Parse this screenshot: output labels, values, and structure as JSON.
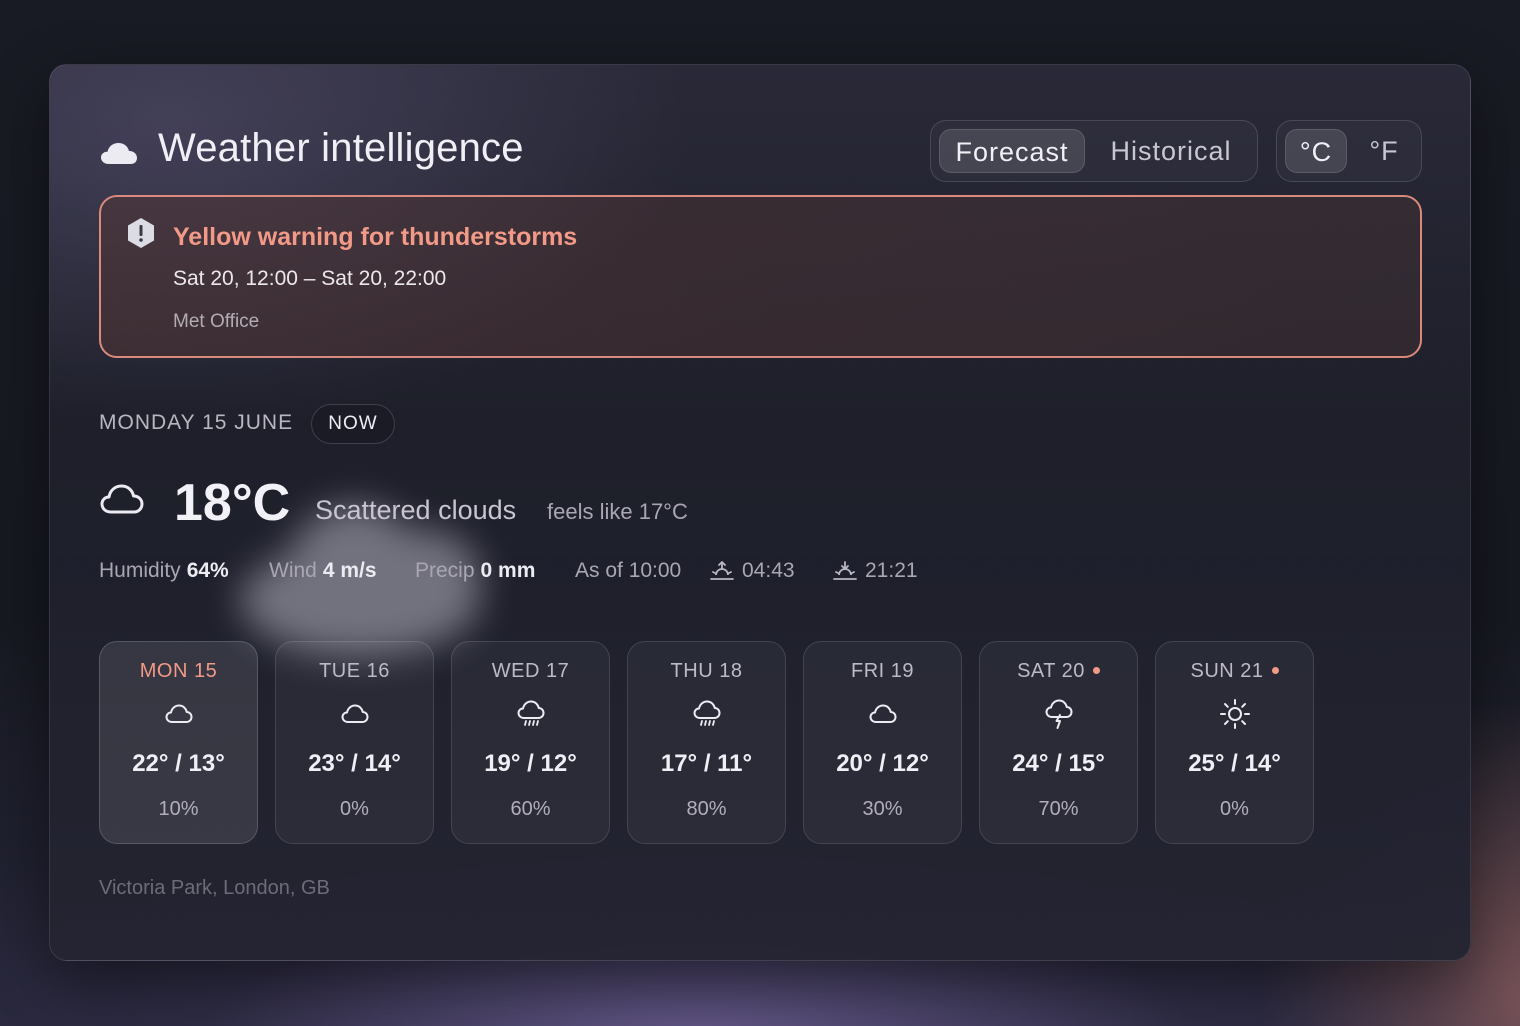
{
  "app": {
    "title": "Weather intelligence",
    "title_icon": "cloud-icon"
  },
  "view_toggle": {
    "options": [
      {
        "label": "Forecast",
        "active": true
      },
      {
        "label": "Historical",
        "active": false
      }
    ]
  },
  "unit_toggle": {
    "options": [
      {
        "label": "°C",
        "active": true
      },
      {
        "label": "°F",
        "active": false
      }
    ]
  },
  "alert": {
    "icon": "warning-icon",
    "title": "Yellow warning for thunderstorms",
    "time": "Sat 20, 12:00 – Sat 20, 22:00",
    "source": "Met Office",
    "accent": "#f29a87"
  },
  "current": {
    "date": "MONDAY 15 JUNE",
    "badge": "NOW",
    "icon": "cloud-icon",
    "temperature": "18°C",
    "description": "Scattered clouds",
    "feels_like": "feels like 17°C",
    "humidity_label": "Humidity",
    "humidity_value": "64%",
    "wind_label": "Wind",
    "wind_value": "4 m/s",
    "precip_label": "Precip",
    "precip_value": "0 mm",
    "as_of": "As of 10:00",
    "sunrise": "04:43",
    "sunset": "21:21"
  },
  "forecast": [
    {
      "day": "MON 15",
      "icon": "cloud-icon",
      "temps": "22° / 13°",
      "precip": "10%",
      "selected": true,
      "alert_dot": false
    },
    {
      "day": "TUE 16",
      "icon": "cloud-icon",
      "temps": "23° / 14°",
      "precip": "0%",
      "selected": false,
      "alert_dot": false
    },
    {
      "day": "WED 17",
      "icon": "rain-icon",
      "temps": "19° / 12°",
      "precip": "60%",
      "selected": false,
      "alert_dot": false
    },
    {
      "day": "THU 18",
      "icon": "rain-icon",
      "temps": "17° / 11°",
      "precip": "80%",
      "selected": false,
      "alert_dot": false
    },
    {
      "day": "FRI 19",
      "icon": "cloud-icon",
      "temps": "20° / 12°",
      "precip": "30%",
      "selected": false,
      "alert_dot": false
    },
    {
      "day": "SAT 20",
      "icon": "thunderstorm-icon",
      "temps": "24° / 15°",
      "precip": "70%",
      "selected": false,
      "alert_dot": true
    },
    {
      "day": "SUN 21",
      "icon": "sun-icon",
      "temps": "25° / 14°",
      "precip": "0%",
      "selected": false,
      "alert_dot": true
    }
  ],
  "location": "Victoria Park, London, GB"
}
